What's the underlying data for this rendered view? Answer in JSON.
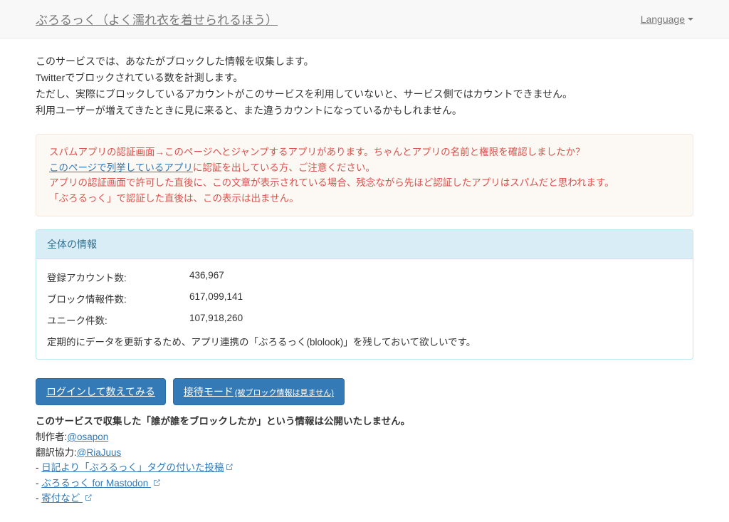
{
  "header": {
    "brand": "ぶろるっく（よく濡れ衣を着せられるほう）",
    "language": "Language"
  },
  "intro": {
    "line1": "このサービスでは、あなたがブロックした情報を収集します。",
    "line2": "Twitterでブロックされている数を計測します。",
    "line3": "ただし、実際にブロックしているアカウントがこのサービスを利用していないと、サービス側ではカウントできません。",
    "line4": "利用ユーザーが増えてきたときに見に来ると、また違うカウントになっているかもしれません。"
  },
  "warning": {
    "line1_pre": "スパムアプリの認証画面→このページへとジャンプするアプリがあります。ちゃんとアプリの名前と権限を確認しましたか？",
    "link_text": "このページで列挙しているアプリ",
    "line2_post": "に認証を出している方、ご注意ください。",
    "line3": "アプリの認証画面で許可した直後に、この文章が表示されている場合、残念ながら先ほど認証したアプリはスパムだと思われます。",
    "line4": "「ぶろるっく」で認証した直後は、この表示は出ません。"
  },
  "panel": {
    "title": "全体の情報",
    "rows": [
      {
        "label": "登録アカウント数:",
        "value": "436,967"
      },
      {
        "label": "ブロック情報件数:",
        "value": "617,099,141"
      },
      {
        "label": "ユニーク件数:",
        "value": "107,918,260"
      }
    ],
    "note": "定期的にデータを更新するため、アプリ連携の「ぶろるっく(blolook)」を残しておいて欲しいです。"
  },
  "buttons": {
    "login": "ログインして数えてみる",
    "host_main": "接待モード",
    "host_sub": "(被ブロック情報は見ません)"
  },
  "footer": {
    "disclaimer": "このサービスで収集した「誰が誰をブロックしたか」という情報は公開いたしません。",
    "author_label": "制作者:",
    "author_handle": "@osapon",
    "translator_label": "翻訳協力:",
    "translator_handle": "@RiaJuus",
    "links": [
      "日記より「ぶろるっく」タグの付いた投稿",
      "ぶろるっく for Mastodon ",
      "寄付など "
    ]
  }
}
